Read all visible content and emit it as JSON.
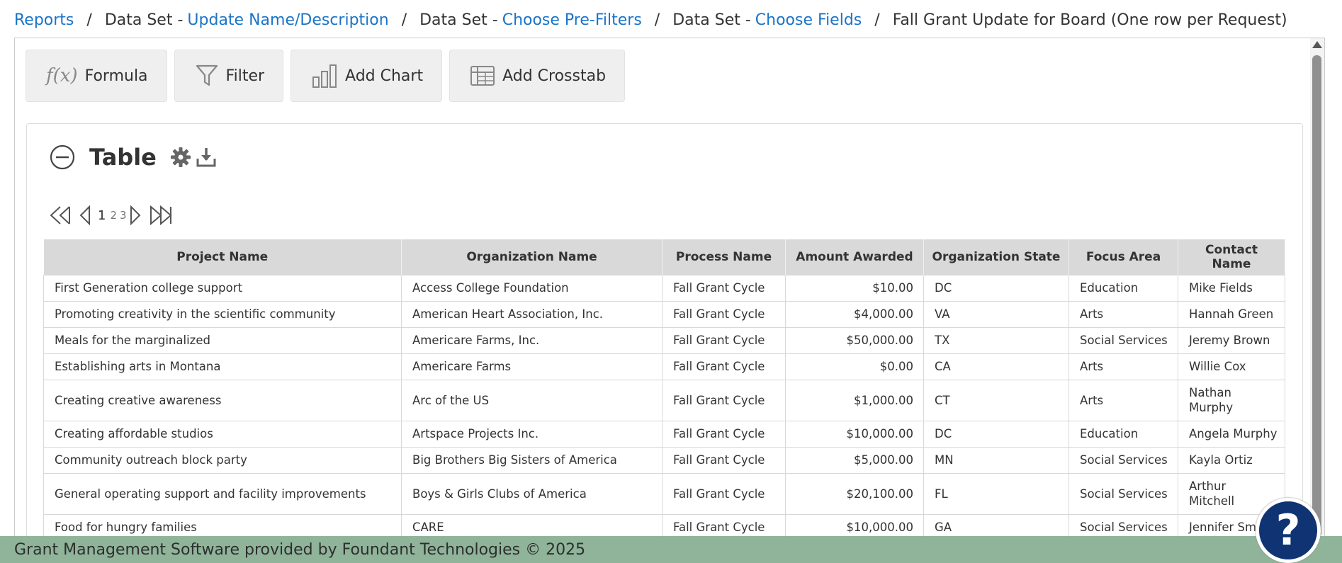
{
  "breadcrumb": {
    "reports": "Reports",
    "sep": "/",
    "ds_prefix": "Data Set - ",
    "update_name": "Update Name/Description",
    "choose_prefilters": "Choose Pre-Filters",
    "choose_fields": "Choose Fields",
    "current": "Fall Grant Update for Board (One row per Request)"
  },
  "toolbar": {
    "formula_icon": "f(x)",
    "formula": "Formula",
    "filter": "Filter",
    "add_chart": "Add Chart",
    "add_crosstab": "Add Crosstab"
  },
  "section": {
    "title": "Table",
    "icons": [
      "collapse-icon",
      "gear-icon",
      "download-icon"
    ]
  },
  "pager": {
    "pages": [
      "1",
      "2",
      "3"
    ],
    "current": "1"
  },
  "table": {
    "columns": [
      "Project Name",
      "Organization Name",
      "Process Name",
      "Amount Awarded",
      "Organization State",
      "Focus Area",
      "Contact Name"
    ],
    "rows": [
      [
        "First Generation college support",
        "Access College Foundation",
        "Fall Grant Cycle",
        "$10.00",
        "DC",
        "Education",
        "Mike Fields"
      ],
      [
        "Promoting creativity in the scientific community",
        "American Heart Association, Inc.",
        "Fall Grant Cycle",
        "$4,000.00",
        "VA",
        "Arts",
        "Hannah Green"
      ],
      [
        "Meals for the marginalized",
        "Americare Farms, Inc.",
        "Fall Grant Cycle",
        "$50,000.00",
        "TX",
        "Social Services",
        "Jeremy Brown"
      ],
      [
        "Establishing arts in Montana",
        "Americare Farms",
        "Fall Grant Cycle",
        "$0.00",
        "CA",
        "Arts",
        "Willie Cox"
      ],
      [
        "Creating creative awareness",
        "Arc of the US",
        "Fall Grant Cycle",
        "$1,000.00",
        "CT",
        "Arts",
        "Nathan Murphy"
      ],
      [
        "Creating affordable studios",
        "Artspace Projects Inc.",
        "Fall Grant Cycle",
        "$10,000.00",
        "DC",
        "Education",
        "Angela Murphy"
      ],
      [
        "Community outreach block party",
        "Big Brothers Big Sisters of America",
        "Fall Grant Cycle",
        "$5,000.00",
        "MN",
        "Social Services",
        "Kayla Ortiz"
      ],
      [
        "General operating support and facility improvements",
        "Boys & Girls Clubs of America",
        "Fall Grant Cycle",
        "$20,100.00",
        "FL",
        "Social Services",
        "Arthur Mitchell"
      ],
      [
        "Food for hungry families",
        "CARE",
        "Fall Grant Cycle",
        "$10,000.00",
        "GA",
        "Social Services",
        "Jennifer Smith"
      ]
    ]
  },
  "footer": {
    "text": "Grant Management Software provided by Foundant Technologies © 2025"
  },
  "help": {
    "label": "?"
  }
}
